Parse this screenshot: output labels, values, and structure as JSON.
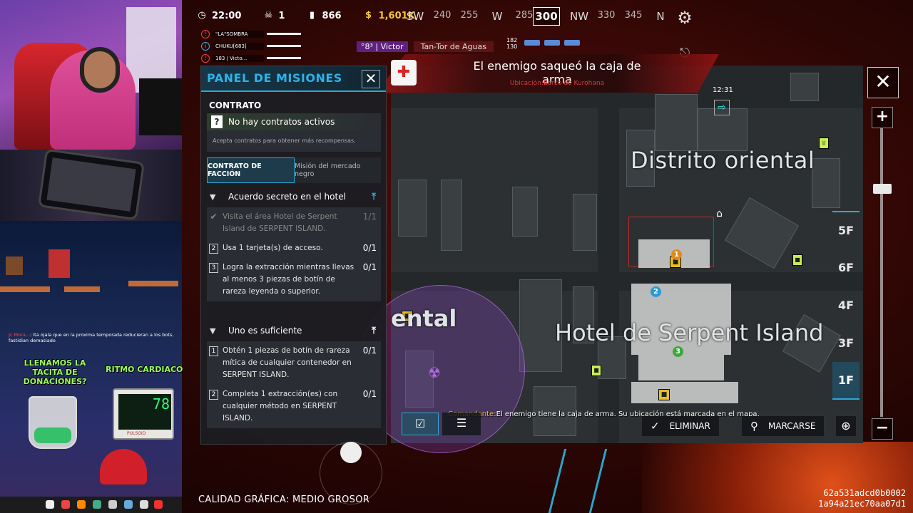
{
  "hud": {
    "time": "22:00",
    "kills": "1",
    "ammo": "866",
    "money": "1,601K",
    "compass": {
      "marks": [
        "SW",
        "240",
        "255",
        "W",
        "285",
        "300",
        "NW",
        "330",
        "345",
        "N"
      ],
      "current": "300"
    },
    "icons": {
      "time": "clock-icon",
      "kills": "skull-icon",
      "ammo": "ammo-icon",
      "money": "dollar-icon",
      "settings": "gear-icon"
    }
  },
  "squad": [
    {
      "name": "\"LA\"SOMBRA",
      "icon": "!"
    },
    {
      "name": "CHUKU[683]",
      "icon": "i"
    },
    {
      "name": "183 | Victo...",
      "icon": "!"
    }
  ],
  "killfeed": {
    "killer": "°8³ | Victor",
    "victim": "Tan-Tor de Aguas",
    "distance_top": "182",
    "distance_bottom": "130"
  },
  "alert": {
    "title": "El enemigo saqueó la caja de arma",
    "subtitle": "Ubicación:Barco de Kurohana",
    "icon": "medkit-icon"
  },
  "map_clock": "12:31",
  "map_labels": {
    "district": "Distrito oriental",
    "hotel": "Hotel de Serpent Island",
    "partial": "ental"
  },
  "floors": [
    "5F",
    "6F",
    "4F",
    "3F",
    "1F"
  ],
  "active_floor": "1F",
  "commander": {
    "label": "Comandante:",
    "message": "El enemigo tiene la caja de arma. Su ubicación está marcada en el mapa."
  },
  "map_buttons": {
    "eliminate": "ELIMINAR",
    "mark": "MARCARSE"
  },
  "panel": {
    "title": "PANEL DE MISIONES",
    "contract_label": "CONTRATO",
    "no_contracts": "No hay contratos activos",
    "contract_hint": "Acepta contratos para obtener más recompensas.",
    "tabs": [
      "CONTRATO DE FACCIÓN",
      "Misión del mercado negro"
    ],
    "missions": [
      {
        "title": "Acuerdo secreto en el hotel",
        "pin_color": "#2cb4e8",
        "objectives": [
          {
            "n": "✔",
            "text": "Visita el área Hotel de Serpent Island de SERPENT ISLAND.",
            "progress": "1/1",
            "done": true
          },
          {
            "n": "2",
            "text": "Usa 1 tarjeta(s) de acceso.",
            "progress": "0/1",
            "done": false
          },
          {
            "n": "3",
            "text": "Logra la extracción mientras llevas al menos 3 piezas de botín de rareza leyenda o superior.",
            "progress": "0/1",
            "done": false
          }
        ]
      },
      {
        "title": "Uno es suficiente",
        "pin_color": "#ffffff",
        "objectives": [
          {
            "n": "1",
            "text": "Obtén 1 piezas de botín de rareza mítica de cualquier contenedor en SERPENT ISLAND.",
            "progress": "0/1",
            "done": false
          },
          {
            "n": "2",
            "text": "Completa 1 extracción(es) con cualquier método en SERPENT ISLAND.",
            "progress": "0/1",
            "done": false
          }
        ]
      }
    ]
  },
  "overlay": {
    "chat_name": "Jc Mora...",
    "chat_text": ": Ita ojala que en la proxima temporada reducieran a los bots, fastidian demasiado",
    "donations": "LLENAMOS LA TACITA DE DONACIONES?",
    "heart_label": "RITMO CARDIACO",
    "bpm": "78",
    "pulse_label": "PULSOID"
  },
  "quality_label": "CALIDAD GRÁFICA: MEDIO GROSOR",
  "session_id": [
    "62a531adcd0b0002",
    "1a94a21ec70aa07d1"
  ],
  "colors": {
    "accent": "#2ca9d6",
    "money": "#f5c431",
    "alert_red": "#c02828",
    "objective_yellow": "#e8c020"
  }
}
